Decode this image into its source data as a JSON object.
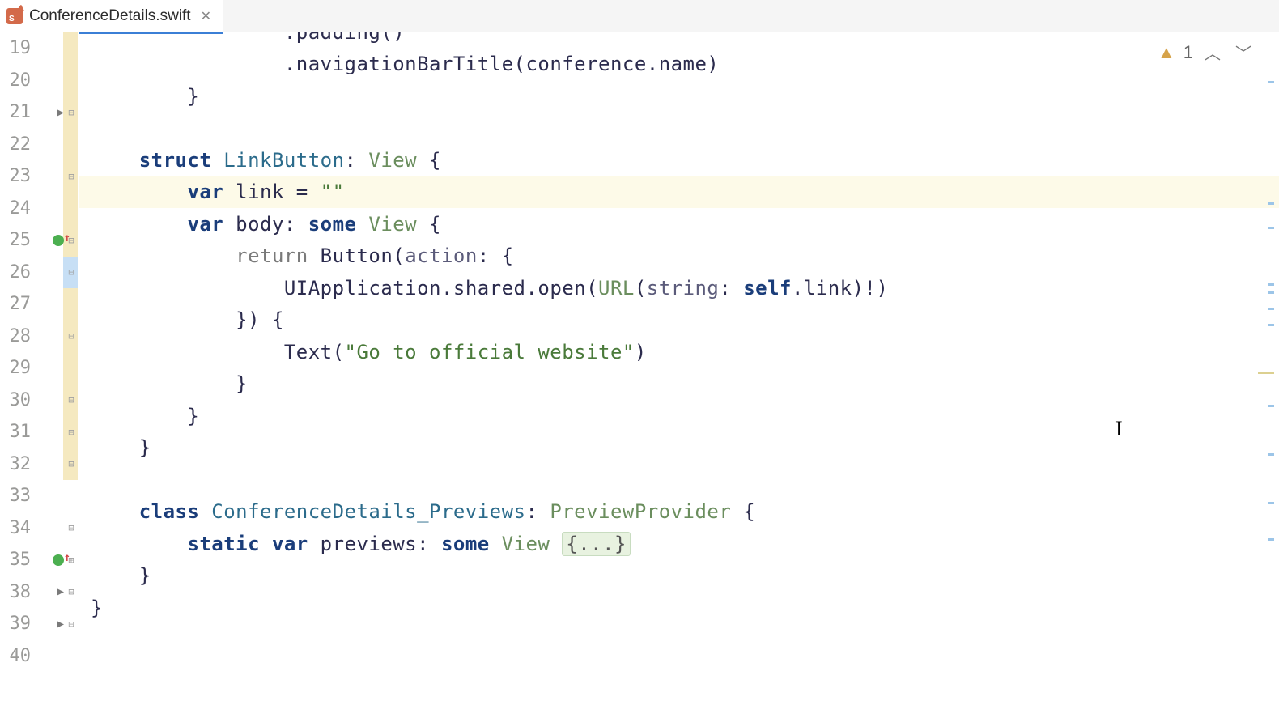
{
  "tab": {
    "filename": "ConferenceDetails.swift"
  },
  "problems": {
    "warning_count": "1"
  },
  "lines": [
    {
      "n": "19",
      "tokens": [
        {
          "t": "                .",
          "c": "plain"
        },
        {
          "t": "padding",
          "c": "plain"
        },
        {
          "t": "()",
          "c": "plain"
        }
      ],
      "cut": true
    },
    {
      "n": "20",
      "tokens": [
        {
          "t": "                .",
          "c": "plain"
        },
        {
          "t": "navigationBarTitle",
          "c": "plain"
        },
        {
          "t": "(",
          "c": "plain"
        },
        {
          "t": "conference",
          "c": "plain"
        },
        {
          "t": ".",
          "c": "plain"
        },
        {
          "t": "name",
          "c": "plain"
        },
        {
          "t": ")",
          "c": "plain"
        }
      ]
    },
    {
      "n": "21",
      "tokens": [
        {
          "t": "        }",
          "c": "plain"
        }
      ]
    },
    {
      "n": "22",
      "tokens": []
    },
    {
      "n": "23",
      "tokens": [
        {
          "t": "    ",
          "c": ""
        },
        {
          "t": "struct ",
          "c": "kw"
        },
        {
          "t": "LinkButton",
          "c": "type"
        },
        {
          "t": ": ",
          "c": "plain"
        },
        {
          "t": "View",
          "c": "type2"
        },
        {
          "t": " {",
          "c": "plain"
        }
      ]
    },
    {
      "n": "24",
      "highlight": true,
      "tokens": [
        {
          "t": "        ",
          "c": ""
        },
        {
          "t": "var ",
          "c": "kw"
        },
        {
          "t": "link",
          "c": "plain"
        },
        {
          "t": " = ",
          "c": "plain"
        },
        {
          "t": "\"\"",
          "c": "str"
        }
      ]
    },
    {
      "n": "25",
      "tokens": [
        {
          "t": "        ",
          "c": ""
        },
        {
          "t": "var ",
          "c": "kw"
        },
        {
          "t": "body",
          "c": "plain"
        },
        {
          "t": ": ",
          "c": "plain"
        },
        {
          "t": "some ",
          "c": "kw"
        },
        {
          "t": "View",
          "c": "type2"
        },
        {
          "t": " {",
          "c": "plain"
        }
      ]
    },
    {
      "n": "26",
      "tokens": [
        {
          "t": "            ",
          "c": ""
        },
        {
          "t": "return ",
          "c": "muted"
        },
        {
          "t": "Button",
          "c": "plain"
        },
        {
          "t": "(",
          "c": "plain"
        },
        {
          "t": "action",
          "c": "param"
        },
        {
          "t": ": {",
          "c": "plain"
        }
      ]
    },
    {
      "n": "27",
      "tokens": [
        {
          "t": "                UIApplication.",
          "c": "plain"
        },
        {
          "t": "shared",
          "c": "plain"
        },
        {
          "t": ".open(",
          "c": "plain"
        },
        {
          "t": "URL",
          "c": "type2"
        },
        {
          "t": "(",
          "c": "plain"
        },
        {
          "t": "string",
          "c": "param"
        },
        {
          "t": ": ",
          "c": "plain"
        },
        {
          "t": "self",
          "c": "kw"
        },
        {
          "t": ".link)!)",
          "c": "plain"
        }
      ]
    },
    {
      "n": "28",
      "tokens": [
        {
          "t": "            }) {",
          "c": "plain"
        }
      ]
    },
    {
      "n": "29",
      "tokens": [
        {
          "t": "                Text(",
          "c": "plain"
        },
        {
          "t": "\"Go to official website\"",
          "c": "str"
        },
        {
          "t": ")",
          "c": "plain"
        }
      ]
    },
    {
      "n": "30",
      "tokens": [
        {
          "t": "            }",
          "c": "plain"
        }
      ]
    },
    {
      "n": "31",
      "tokens": [
        {
          "t": "        }",
          "c": "plain"
        }
      ]
    },
    {
      "n": "32",
      "tokens": [
        {
          "t": "    }",
          "c": "plain"
        }
      ]
    },
    {
      "n": "33",
      "tokens": []
    },
    {
      "n": "34",
      "tokens": [
        {
          "t": "    ",
          "c": ""
        },
        {
          "t": "class ",
          "c": "kw"
        },
        {
          "t": "ConferenceDetails_Previews",
          "c": "type"
        },
        {
          "t": ": ",
          "c": "plain"
        },
        {
          "t": "PreviewProvider",
          "c": "type2"
        },
        {
          "t": " {",
          "c": "plain"
        }
      ]
    },
    {
      "n": "35",
      "tokens": [
        {
          "t": "        ",
          "c": ""
        },
        {
          "t": "static var ",
          "c": "kw"
        },
        {
          "t": "previews",
          "c": "plain"
        },
        {
          "t": ": ",
          "c": "plain"
        },
        {
          "t": "some ",
          "c": "kw"
        },
        {
          "t": "View",
          "c": "type2"
        },
        {
          "t": " ",
          "c": ""
        },
        {
          "t": "{...}",
          "c": "folded"
        }
      ]
    },
    {
      "n": "38",
      "tokens": [
        {
          "t": "    }",
          "c": "plain"
        }
      ]
    },
    {
      "n": "39",
      "tokens": [
        {
          "t": "}",
          "c": "plain"
        }
      ]
    },
    {
      "n": "40",
      "tokens": []
    }
  ],
  "gutter_strips": {
    "yellow": [
      {
        "from": 0,
        "to": 14
      }
    ],
    "blue": [
      {
        "from": 7,
        "to": 8
      }
    ]
  },
  "fold_markers": {
    "19": "",
    "21": "minus",
    "23": "minus",
    "25": "minus",
    "26": "minus",
    "28": "minus",
    "30": "minus",
    "31": "minus",
    "32": "minus",
    "34": "minus",
    "35": "plus",
    "38": "minus",
    "39": "minus"
  },
  "vcs_markers": [
    "25",
    "35"
  ],
  "run_markers": [
    "21",
    "38",
    "39"
  ]
}
